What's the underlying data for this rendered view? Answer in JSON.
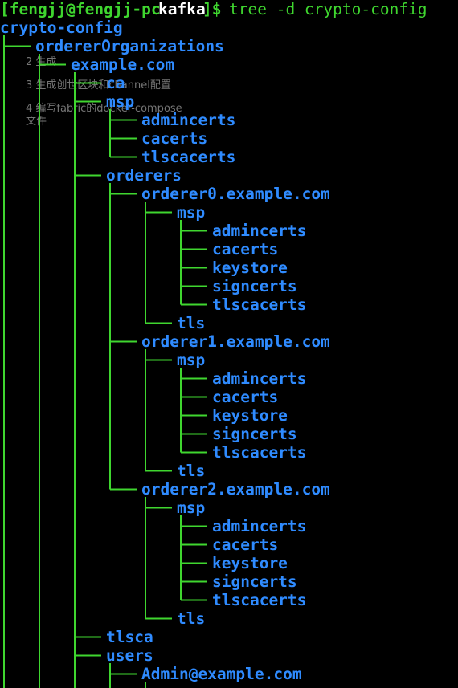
{
  "prompt": {
    "text": "[fengjj@fengjj-pc ",
    "dir": "kafka",
    "end": "]$ ",
    "command": "tree -d crypto-config"
  },
  "tree": [
    {
      "name": "crypto-config",
      "depth": 0
    },
    {
      "name": "ordererOrganizations",
      "depth": 1
    },
    {
      "name": "example.com",
      "depth": 2
    },
    {
      "name": "ca",
      "depth": 3
    },
    {
      "name": "msp",
      "depth": 3
    },
    {
      "name": "admincerts",
      "depth": 4
    },
    {
      "name": "cacerts",
      "depth": 4
    },
    {
      "name": "tlscacerts",
      "depth": 4
    },
    {
      "name": "orderers",
      "depth": 3
    },
    {
      "name": "orderer0.example.com",
      "depth": 4
    },
    {
      "name": "msp",
      "depth": 5
    },
    {
      "name": "admincerts",
      "depth": 6
    },
    {
      "name": "cacerts",
      "depth": 6
    },
    {
      "name": "keystore",
      "depth": 6
    },
    {
      "name": "signcerts",
      "depth": 6
    },
    {
      "name": "tlscacerts",
      "depth": 6
    },
    {
      "name": "tls",
      "depth": 5
    },
    {
      "name": "orderer1.example.com",
      "depth": 4
    },
    {
      "name": "msp",
      "depth": 5
    },
    {
      "name": "admincerts",
      "depth": 6
    },
    {
      "name": "cacerts",
      "depth": 6
    },
    {
      "name": "keystore",
      "depth": 6
    },
    {
      "name": "signcerts",
      "depth": 6
    },
    {
      "name": "tlscacerts",
      "depth": 6
    },
    {
      "name": "tls",
      "depth": 5
    },
    {
      "name": "orderer2.example.com",
      "depth": 4
    },
    {
      "name": "msp",
      "depth": 5
    },
    {
      "name": "admincerts",
      "depth": 6
    },
    {
      "name": "cacerts",
      "depth": 6
    },
    {
      "name": "keystore",
      "depth": 6
    },
    {
      "name": "signcerts",
      "depth": 6
    },
    {
      "name": "tlscacerts",
      "depth": 6
    },
    {
      "name": "tls",
      "depth": 5
    },
    {
      "name": "tlsca",
      "depth": 3
    },
    {
      "name": "users",
      "depth": 3
    },
    {
      "name": "Admin@example.com",
      "depth": 4
    }
  ],
  "overlay": {
    "item2": "2 生成",
    "item3": "3 生成创世区块和channel配置",
    "item4a": "4 编写fabric的docker-compose",
    "item4b": "文件"
  },
  "colors": {
    "background": "#000000",
    "green": "#3fd62f",
    "blue": "#2f8bff"
  }
}
